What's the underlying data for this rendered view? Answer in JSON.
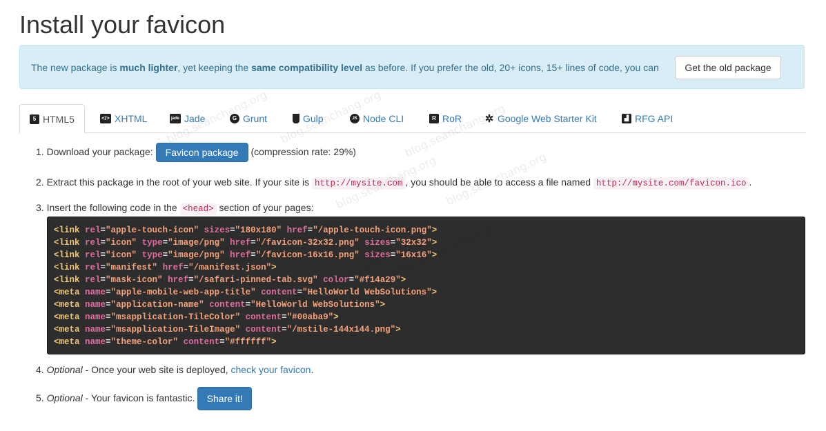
{
  "page": {
    "title": "Install your favicon"
  },
  "alert": {
    "text_1": "The new package is ",
    "bold_1": "much lighter",
    "text_2": ", yet keeping the ",
    "bold_2": "same compatibility level",
    "text_3": " as before. If you prefer the old, 20+ icons, 15+ lines of code, you can",
    "button": "Get the old package"
  },
  "tabs": [
    {
      "label": "HTML5",
      "icon": "html5-icon",
      "active": true
    },
    {
      "label": "XHTML",
      "icon": "xhtml-icon"
    },
    {
      "label": "Jade",
      "icon": "jade-icon"
    },
    {
      "label": "Grunt",
      "icon": "grunt-icon"
    },
    {
      "label": "Gulp",
      "icon": "gulp-icon"
    },
    {
      "label": "Node CLI",
      "icon": "nodejs-icon"
    },
    {
      "label": "RoR",
      "icon": "rails-icon"
    },
    {
      "label": "Google Web Starter Kit",
      "icon": "gear-icon"
    },
    {
      "label": "RFG API",
      "icon": "api-icon"
    }
  ],
  "steps": {
    "s1": {
      "num": "1.",
      "text": "Download your package:",
      "button": "Favicon package",
      "suffix": "(compression rate: 29%)"
    },
    "s2": {
      "num": "2.",
      "text_1": "Extract this package in the root of your web site. If your site is",
      "code_1": "http://mysite.com",
      "text_2": ", you should be able to access a file named",
      "code_2": "http://mysite.com/favicon.ico",
      "text_3": "."
    },
    "s3": {
      "num": "3.",
      "text_1": "Insert the following code in the",
      "code": "<head>",
      "text_2": "section of your pages:"
    },
    "s4": {
      "num": "4.",
      "optional": "Optional",
      "text": " - Once your web site is deployed, ",
      "link": "check your favicon",
      "text_end": "."
    },
    "s5": {
      "num": "5.",
      "optional": "Optional",
      "text": " - Your favicon is fantastic.",
      "button": "Share it!"
    }
  },
  "code_lines": [
    [
      [
        "t",
        "<link "
      ],
      [
        "a",
        "rel"
      ],
      [
        "p",
        "="
      ],
      [
        "v",
        "\"apple-touch-icon\""
      ],
      [
        "p",
        " "
      ],
      [
        "a",
        "sizes"
      ],
      [
        "p",
        "="
      ],
      [
        "v",
        "\"180x180\""
      ],
      [
        "p",
        " "
      ],
      [
        "a",
        "href"
      ],
      [
        "p",
        "="
      ],
      [
        "v",
        "\"/apple-touch-icon.png\""
      ],
      [
        "t",
        ">"
      ]
    ],
    [
      [
        "t",
        "<link "
      ],
      [
        "a",
        "rel"
      ],
      [
        "p",
        "="
      ],
      [
        "v",
        "\"icon\""
      ],
      [
        "p",
        " "
      ],
      [
        "a",
        "type"
      ],
      [
        "p",
        "="
      ],
      [
        "v",
        "\"image/png\""
      ],
      [
        "p",
        " "
      ],
      [
        "a",
        "href"
      ],
      [
        "p",
        "="
      ],
      [
        "v",
        "\"/favicon-32x32.png\""
      ],
      [
        "p",
        " "
      ],
      [
        "a",
        "sizes"
      ],
      [
        "p",
        "="
      ],
      [
        "v",
        "\"32x32\""
      ],
      [
        "t",
        ">"
      ]
    ],
    [
      [
        "t",
        "<link "
      ],
      [
        "a",
        "rel"
      ],
      [
        "p",
        "="
      ],
      [
        "v",
        "\"icon\""
      ],
      [
        "p",
        " "
      ],
      [
        "a",
        "type"
      ],
      [
        "p",
        "="
      ],
      [
        "v",
        "\"image/png\""
      ],
      [
        "p",
        " "
      ],
      [
        "a",
        "href"
      ],
      [
        "p",
        "="
      ],
      [
        "v",
        "\"/favicon-16x16.png\""
      ],
      [
        "p",
        " "
      ],
      [
        "a",
        "sizes"
      ],
      [
        "p",
        "="
      ],
      [
        "v",
        "\"16x16\""
      ],
      [
        "t",
        ">"
      ]
    ],
    [
      [
        "t",
        "<link "
      ],
      [
        "a",
        "rel"
      ],
      [
        "p",
        "="
      ],
      [
        "v",
        "\"manifest\""
      ],
      [
        "p",
        " "
      ],
      [
        "a",
        "href"
      ],
      [
        "p",
        "="
      ],
      [
        "v",
        "\"/manifest.json\""
      ],
      [
        "t",
        ">"
      ]
    ],
    [
      [
        "t",
        "<link "
      ],
      [
        "a",
        "rel"
      ],
      [
        "p",
        "="
      ],
      [
        "v",
        "\"mask-icon\""
      ],
      [
        "p",
        " "
      ],
      [
        "a",
        "href"
      ],
      [
        "p",
        "="
      ],
      [
        "v",
        "\"/safari-pinned-tab.svg\""
      ],
      [
        "p",
        " "
      ],
      [
        "a",
        "color"
      ],
      [
        "p",
        "="
      ],
      [
        "v",
        "\"#f14a29\""
      ],
      [
        "t",
        ">"
      ]
    ],
    [
      [
        "t",
        "<meta "
      ],
      [
        "a",
        "name"
      ],
      [
        "p",
        "="
      ],
      [
        "v",
        "\"apple-mobile-web-app-title\""
      ],
      [
        "p",
        " "
      ],
      [
        "a",
        "content"
      ],
      [
        "p",
        "="
      ],
      [
        "v",
        "\"HelloWorld WebSolutions\""
      ],
      [
        "t",
        ">"
      ]
    ],
    [
      [
        "t",
        "<meta "
      ],
      [
        "a",
        "name"
      ],
      [
        "p",
        "="
      ],
      [
        "v",
        "\"application-name\""
      ],
      [
        "p",
        " "
      ],
      [
        "a",
        "content"
      ],
      [
        "p",
        "="
      ],
      [
        "v",
        "\"HelloWorld WebSolutions\""
      ],
      [
        "t",
        ">"
      ]
    ],
    [
      [
        "t",
        "<meta "
      ],
      [
        "a",
        "name"
      ],
      [
        "p",
        "="
      ],
      [
        "v",
        "\"msapplication-TileColor\""
      ],
      [
        "p",
        " "
      ],
      [
        "a",
        "content"
      ],
      [
        "p",
        "="
      ],
      [
        "v",
        "\"#00aba9\""
      ],
      [
        "t",
        ">"
      ]
    ],
    [
      [
        "t",
        "<meta "
      ],
      [
        "a",
        "name"
      ],
      [
        "p",
        "="
      ],
      [
        "v",
        "\"msapplication-TileImage\""
      ],
      [
        "p",
        " "
      ],
      [
        "a",
        "content"
      ],
      [
        "p",
        "="
      ],
      [
        "v",
        "\"/mstile-144x144.png\""
      ],
      [
        "t",
        ">"
      ]
    ],
    [
      [
        "t",
        "<meta "
      ],
      [
        "a",
        "name"
      ],
      [
        "p",
        "="
      ],
      [
        "v",
        "\"theme-color\""
      ],
      [
        "p",
        " "
      ],
      [
        "a",
        "content"
      ],
      [
        "p",
        "="
      ],
      [
        "v",
        "\"#ffffff\""
      ],
      [
        "t",
        ">"
      ]
    ]
  ],
  "watermark": "blog.seanchang.org",
  "colors": {
    "link": "#337ab7",
    "alert_bg": "#d9edf7",
    "alert_text": "#31708f",
    "code_bg": "#2d2d2d"
  }
}
